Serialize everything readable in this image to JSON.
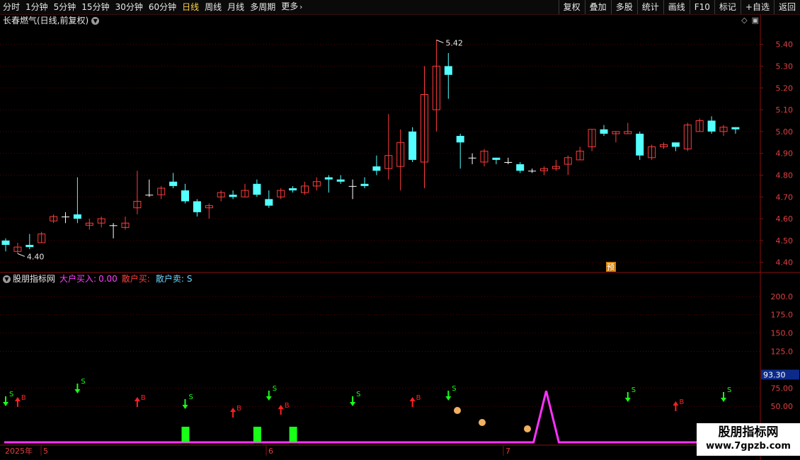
{
  "toolbar": {
    "periods": [
      "分时",
      "1分钟",
      "5分钟",
      "15分钟",
      "30分钟",
      "60分钟",
      "日线",
      "周线",
      "月线",
      "多周期",
      "更多"
    ],
    "active_index": 6,
    "right_buttons": [
      "复权",
      "叠加",
      "多股",
      "统计",
      "画线",
      "F10",
      "标记",
      "+自选",
      "返回"
    ]
  },
  "stock": {
    "title": "长春燃气(日线,前复权)",
    "high_label": "5.42",
    "low_label": "4.40",
    "forecast_tag": "预"
  },
  "price_axis": [
    "5.40",
    "5.30",
    "5.20",
    "5.10",
    "5.00",
    "4.90",
    "4.80",
    "4.70",
    "4.60",
    "4.50",
    "4.40"
  ],
  "indicator": {
    "name": "股朋指标网",
    "k1": "大户买入:",
    "v1": "0.00",
    "k2": "散户买:",
    "k3": "散户卖:",
    "v3": "S",
    "axis": [
      "200.0",
      "175.0",
      "150.0",
      "125.0",
      "75.00",
      "50.00"
    ],
    "current": "93.30"
  },
  "date_axis": {
    "year": "2025年",
    "months": [
      "5",
      "6",
      "7"
    ]
  },
  "watermark": {
    "line1": "股朋指标网",
    "line2": "www.7gpzb.com"
  },
  "signals": {
    "buy": "B",
    "sell": "S"
  },
  "colors": {
    "up": "#ff3c3c",
    "down": "#54ffff",
    "magenta": "#ff32ff",
    "green": "#18ff18",
    "grid": "#5a0000"
  },
  "chart_data": {
    "type": "candlestick",
    "price_range": [
      4.36,
      5.48
    ],
    "candles": [
      [
        4.5,
        4.48,
        4.51,
        4.45
      ],
      [
        4.45,
        4.47,
        4.49,
        4.44
      ],
      [
        4.48,
        4.47,
        4.53,
        4.46
      ],
      [
        4.49,
        4.53,
        4.54,
        4.49
      ],
      [
        4.59,
        4.61,
        4.62,
        4.58
      ],
      [
        4.61,
        4.61,
        4.63,
        4.58
      ],
      [
        4.62,
        4.6,
        4.79,
        4.58
      ],
      [
        4.57,
        4.58,
        4.6,
        4.55
      ],
      [
        4.58,
        4.6,
        4.61,
        4.56
      ],
      [
        4.57,
        4.57,
        4.58,
        4.51
      ],
      [
        4.56,
        4.58,
        4.61,
        4.55
      ],
      [
        4.65,
        4.68,
        4.82,
        4.62
      ],
      [
        4.71,
        4.71,
        4.78,
        4.7
      ],
      [
        4.71,
        4.74,
        4.75,
        4.69
      ],
      [
        4.77,
        4.75,
        4.81,
        4.74
      ],
      [
        4.73,
        4.68,
        4.76,
        4.67
      ],
      [
        4.68,
        4.63,
        4.69,
        4.61
      ],
      [
        4.65,
        4.66,
        4.67,
        4.6
      ],
      [
        4.7,
        4.72,
        4.73,
        4.68
      ],
      [
        4.71,
        4.7,
        4.73,
        4.69
      ],
      [
        4.7,
        4.73,
        4.76,
        4.7
      ],
      [
        4.76,
        4.71,
        4.78,
        4.7
      ],
      [
        4.69,
        4.66,
        4.73,
        4.65
      ],
      [
        4.7,
        4.73,
        4.74,
        4.69
      ],
      [
        4.74,
        4.73,
        4.75,
        4.72
      ],
      [
        4.72,
        4.75,
        4.77,
        4.71
      ],
      [
        4.75,
        4.77,
        4.79,
        4.73
      ],
      [
        4.79,
        4.78,
        4.8,
        4.72
      ],
      [
        4.78,
        4.77,
        4.8,
        4.76
      ],
      [
        4.75,
        4.75,
        4.78,
        4.69
      ],
      [
        4.76,
        4.75,
        4.79,
        4.74
      ],
      [
        4.84,
        4.82,
        4.89,
        4.8
      ],
      [
        4.83,
        4.89,
        5.08,
        4.78
      ],
      [
        4.84,
        4.95,
        5.01,
        4.73
      ],
      [
        5.0,
        4.87,
        5.02,
        4.86
      ],
      [
        4.86,
        5.17,
        5.3,
        4.74
      ],
      [
        5.1,
        5.3,
        5.42,
        5.0
      ],
      [
        5.3,
        5.26,
        5.36,
        5.15
      ],
      [
        4.98,
        4.95,
        4.99,
        4.83
      ],
      [
        4.88,
        4.88,
        4.9,
        4.85
      ],
      [
        4.86,
        4.91,
        4.92,
        4.84
      ],
      [
        4.88,
        4.87,
        4.88,
        4.85
      ],
      [
        4.86,
        4.86,
        4.88,
        4.85
      ],
      [
        4.85,
        4.82,
        4.86,
        4.81
      ],
      [
        4.82,
        4.82,
        4.83,
        4.81
      ],
      [
        4.82,
        4.83,
        4.84,
        4.8
      ],
      [
        4.83,
        4.84,
        4.87,
        4.82
      ],
      [
        4.85,
        4.88,
        4.89,
        4.8
      ],
      [
        4.87,
        4.91,
        4.93,
        4.87
      ],
      [
        4.93,
        5.01,
        5.01,
        4.91
      ],
      [
        5.01,
        4.99,
        5.03,
        4.98
      ],
      [
        4.99,
        5.0,
        5.0,
        4.95
      ],
      [
        4.99,
        5.0,
        5.04,
        4.99
      ],
      [
        4.99,
        4.89,
        5.0,
        4.87
      ],
      [
        4.88,
        4.93,
        4.94,
        4.87
      ],
      [
        4.93,
        4.94,
        4.95,
        4.92
      ],
      [
        4.95,
        4.93,
        4.95,
        4.91
      ],
      [
        4.92,
        5.03,
        5.04,
        4.91
      ],
      [
        5.0,
        5.05,
        5.06,
        5.0
      ],
      [
        5.05,
        5.0,
        5.07,
        4.99
      ],
      [
        5.0,
        5.02,
        5.03,
        4.98
      ],
      [
        5.02,
        5.01,
        5.02,
        4.99
      ]
    ],
    "indicator_range": [
      0,
      221
    ],
    "indicator_spike": {
      "peak": 71,
      "baseline": 0
    },
    "green_bars_at": [
      15,
      21,
      24
    ],
    "buy_signals_at": [
      1,
      11,
      19,
      23,
      34,
      56
    ],
    "sell_signals_at": [
      0,
      6,
      15,
      22,
      29,
      37,
      52,
      60
    ]
  }
}
